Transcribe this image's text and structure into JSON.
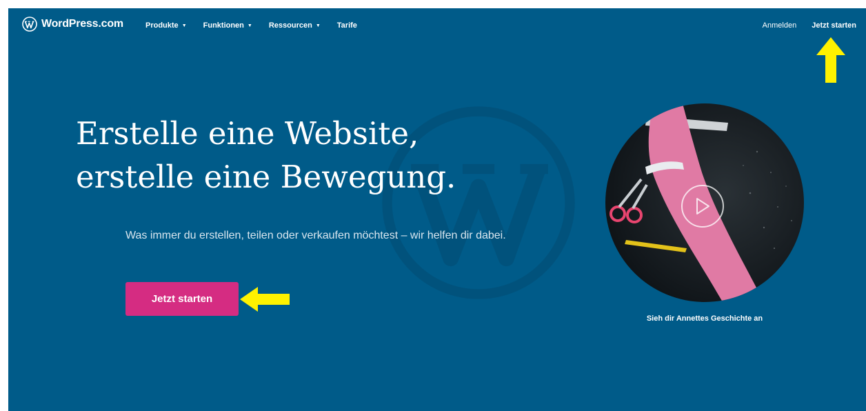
{
  "nav": {
    "brand": "WordPress.com",
    "items": [
      {
        "label": "Produkte",
        "dropdown": true
      },
      {
        "label": "Funktionen",
        "dropdown": true
      },
      {
        "label": "Ressourcen",
        "dropdown": true
      },
      {
        "label": "Tarife",
        "dropdown": false
      }
    ],
    "login": "Anmelden",
    "start": "Jetzt starten"
  },
  "hero": {
    "headline_line1": "Erstelle eine Website,",
    "headline_line2": "erstelle eine Bewegung.",
    "subtext": "Was immer du erstellen, teilen oder verkaufen möchtest – wir helfen dir dabei.",
    "cta": "Jetzt starten"
  },
  "video": {
    "caption": "Sieh dir Annettes Geschichte an"
  },
  "colors": {
    "background": "#005b89",
    "cta": "#d52c82",
    "annotation_arrow": "#fff200"
  },
  "icons": {
    "brand": "wordpress-logo-icon",
    "caret": "caret-down-icon",
    "play": "play-icon",
    "annotation": "yellow-arrow-icon"
  }
}
